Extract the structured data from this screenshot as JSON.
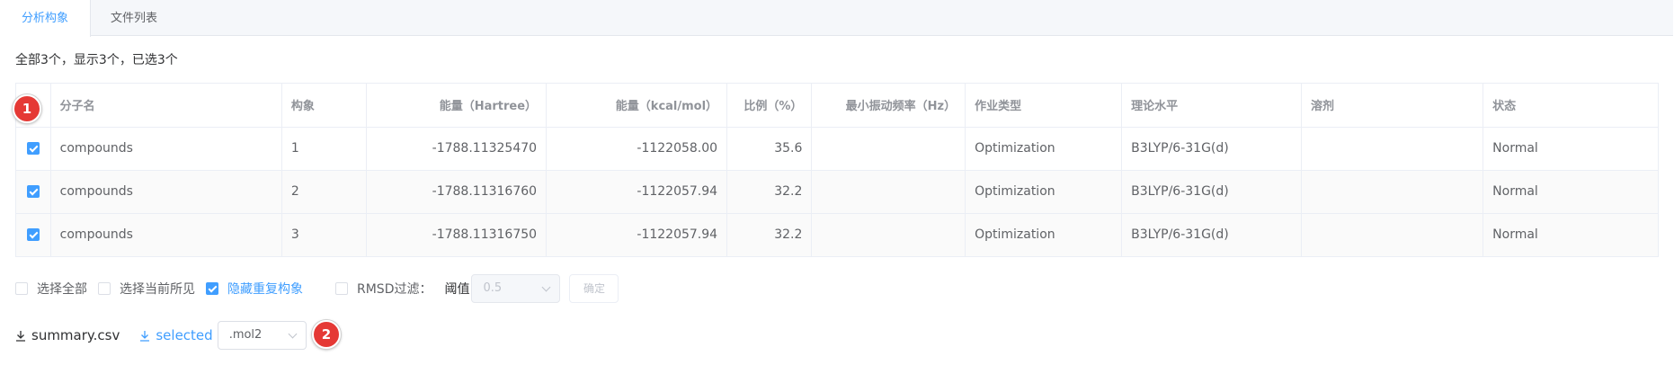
{
  "tabs": [
    {
      "label": "分析构象",
      "active": true
    },
    {
      "label": "文件列表",
      "active": false
    }
  ],
  "summary_text": "全部3个，显示3个，已选3个",
  "table": {
    "columns": [
      "分子名",
      "构象",
      "能量（Hartree）",
      "能量（kcal/mol）",
      "比例（%）",
      "最小振动频率（Hz）",
      "作业类型",
      "理论水平",
      "溶剂",
      "状态"
    ],
    "rows": [
      {
        "checked": true,
        "name": "compounds",
        "conformer": "1",
        "energy_hartree": "-1788.11325470",
        "energy_kcal": "-1122058.00",
        "ratio": "35.6",
        "min_freq": "",
        "job_type": "Optimization",
        "theory": "B3LYP/6-31G(d)",
        "solvent": "",
        "status": "Normal"
      },
      {
        "checked": true,
        "name": "compounds",
        "conformer": "2",
        "energy_hartree": "-1788.11316760",
        "energy_kcal": "-1122057.94",
        "ratio": "32.2",
        "min_freq": "",
        "job_type": "Optimization",
        "theory": "B3LYP/6-31G(d)",
        "solvent": "",
        "status": "Normal"
      },
      {
        "checked": true,
        "name": "compounds",
        "conformer": "3",
        "energy_hartree": "-1788.11316750",
        "energy_kcal": "-1122057.94",
        "ratio": "32.2",
        "min_freq": "",
        "job_type": "Optimization",
        "theory": "B3LYP/6-31G(d)",
        "solvent": "",
        "status": "Normal"
      }
    ]
  },
  "options": {
    "select_all": {
      "label": "选择全部",
      "checked": false
    },
    "select_visible": {
      "label": "选择当前所见",
      "checked": false
    },
    "hide_duplicates": {
      "label": "隐藏重复构象",
      "checked": true
    },
    "rmsd_filter": {
      "label": "RMSD过滤：",
      "checked": false
    },
    "threshold_label": "阈值",
    "threshold_value": "0.5",
    "confirm_label": "确定"
  },
  "downloads": {
    "summary_label": "summary.csv",
    "selected_label": "selected",
    "format_value": ".mol2"
  },
  "markers": {
    "first": "1",
    "second": "2"
  },
  "colors": {
    "accent": "#409eff",
    "marker": "#e53935",
    "header_text": "#909399",
    "body_text": "#606266"
  }
}
